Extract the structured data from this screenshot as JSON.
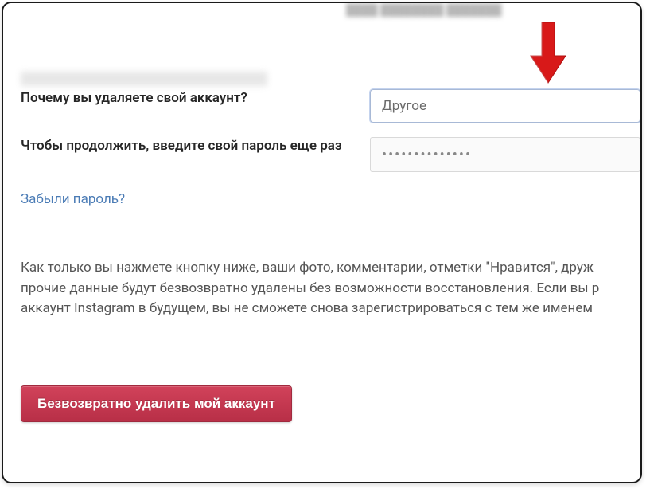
{
  "form": {
    "reason_label": "Почему вы удаляете свой аккаунт?",
    "reason_value": "Другое",
    "password_label": "Чтобы продолжить, введите свой пароль еще раз",
    "password_value": "••••••••••••••",
    "forgot_password": "Забыли пароль?"
  },
  "info": {
    "warning_text": "Как только вы нажмете кнопку ниже, ваши фото, комментарии, отметки \"Нравится\", друж прочие данные будут безвозвратно удалены без возможности восстановления. Если вы р аккаунт Instagram в будущем, вы не сможете снова зарегистрироваться с тем же именем"
  },
  "buttons": {
    "delete_label": "Безвозвратно удалить мой аккаунт"
  }
}
